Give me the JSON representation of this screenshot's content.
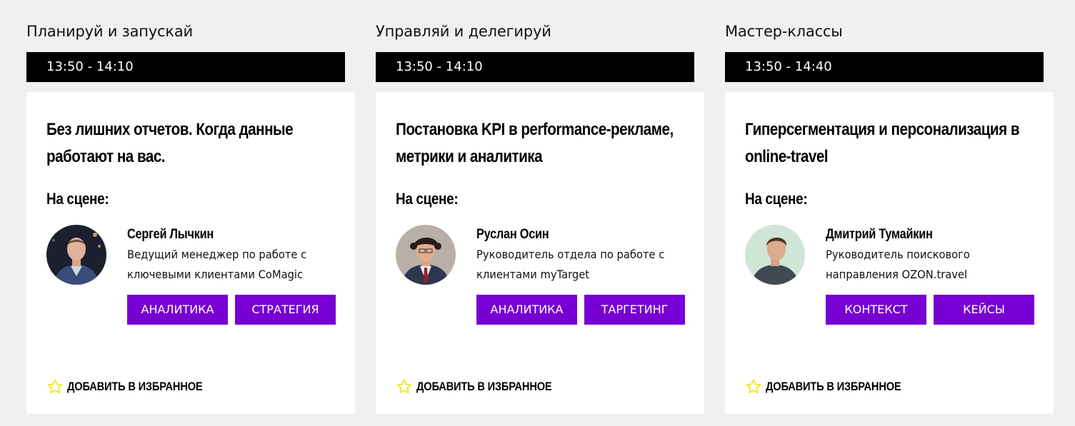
{
  "sessions": [
    {
      "track": "Планируй и запускай",
      "time": "13:50 - 14:10",
      "title_lines": [
        "Без лишних отчетов. Когда данные",
        "работают на вас."
      ],
      "stage_label": "На сцене:",
      "speaker": {
        "name": "Сергей Лычкин",
        "role_lines": [
          "Ведущий менеджер по работе с",
          "ключевыми клиентами CoMagic"
        ]
      },
      "tags": [
        "АНАЛИТИКА",
        "СТРАТЕГИЯ"
      ],
      "favorite_label": "ДОБАВИТЬ В ИЗБРАННОЕ"
    },
    {
      "track": "Управляй и делегируй",
      "time": "13:50 - 14:10",
      "title_lines": [
        "Постановка KPI в performance-рекламе,",
        "метрики и аналитика"
      ],
      "stage_label": "На сцене:",
      "speaker": {
        "name": "Руслан Осин",
        "role_lines": [
          "Руководитель отдела по работе с",
          "клиентами myTarget"
        ]
      },
      "tags": [
        "АНАЛИТИКА",
        "ТАРГЕТИНГ"
      ],
      "favorite_label": "ДОБАВИТЬ В ИЗБРАННОЕ"
    },
    {
      "track": "Мастер-классы",
      "time": "13:50 - 14:40",
      "title_lines": [
        "Гиперсегментация и персонализация в",
        "online-travel"
      ],
      "stage_label": "На сцене:",
      "speaker": {
        "name": "Дмитрий Тумайкин",
        "role_lines": [
          "Руководитель поискового",
          "направления OZON.travel"
        ]
      },
      "tags": [
        "КОНТЕКСТ",
        "КЕЙСЫ"
      ],
      "favorite_label": "ДОБАВИТЬ В ИЗБРАННОЕ"
    }
  ],
  "colors": {
    "page_background": "#f0f0f0",
    "time_bar": "#000000",
    "tag_background": "#7700d4",
    "tag_text": "#ffffff",
    "star": "#f2e600"
  },
  "icons": {
    "favorite": "star-outline-icon",
    "avatar": "speaker-photo"
  }
}
